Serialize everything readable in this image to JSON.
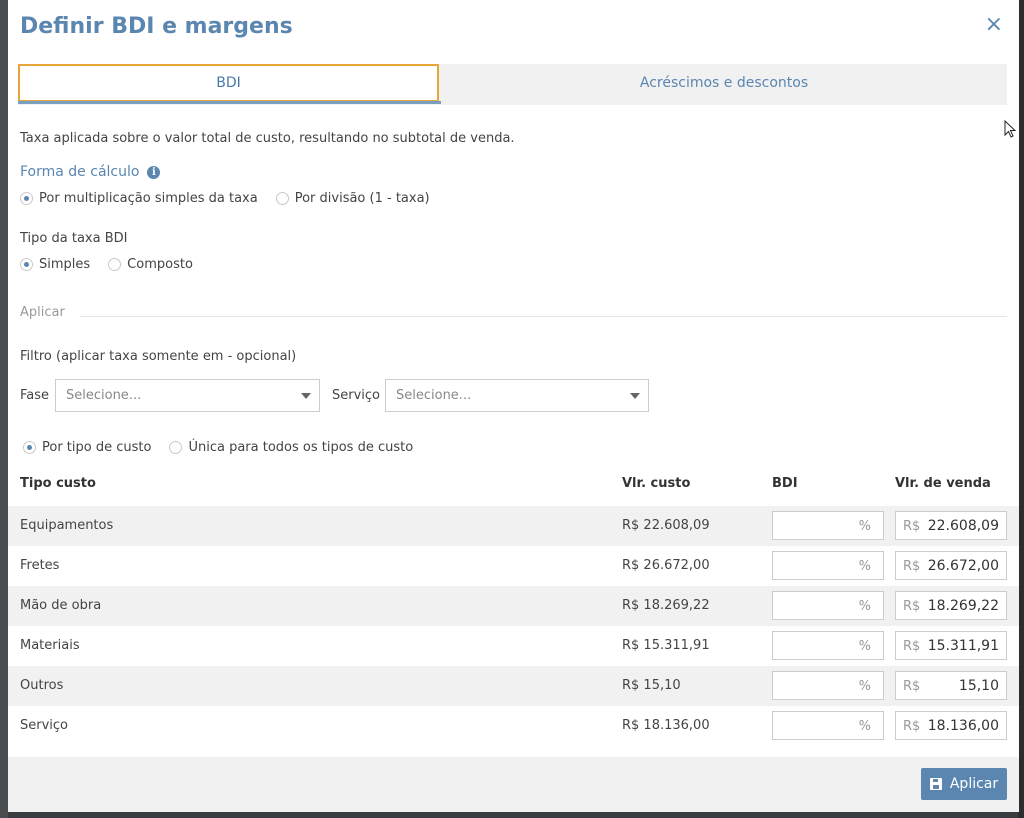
{
  "dialog": {
    "title": "Definir BDI e margens",
    "close_symbol": "×"
  },
  "tabs": [
    {
      "label": "BDI",
      "active": true
    },
    {
      "label": "Acréscimos e descontos",
      "active": false
    }
  ],
  "description": "Taxa aplicada sobre o valor total de custo, resultando no subtotal de venda.",
  "forma_calculo": {
    "label": "Forma de cálculo",
    "info_symbol": "i",
    "options": [
      {
        "label": "Por multiplicação simples da taxa",
        "checked": true
      },
      {
        "label": "Por divisão (1 - taxa)",
        "checked": false
      }
    ]
  },
  "tipo_taxa": {
    "label": "Tipo da taxa BDI",
    "options": [
      {
        "label": "Simples",
        "checked": true
      },
      {
        "label": "Composto",
        "checked": false
      }
    ]
  },
  "aplicar": {
    "heading": "Aplicar",
    "filter_label": "Filtro (aplicar taxa somente em - opcional)",
    "fase_label": "Fase",
    "fase_placeholder": "Selecione...",
    "servico_label": "Serviço",
    "servico_placeholder": "Selecione...",
    "mode_options": [
      {
        "label": "Por tipo de custo",
        "checked": true
      },
      {
        "label": "Única para todos os tipos de custo",
        "checked": false
      }
    ]
  },
  "table": {
    "headers": {
      "tipo": "Tipo custo",
      "custo": "Vlr. custo",
      "bdi": "BDI",
      "venda": "Vlr. de venda"
    },
    "pct_suffix": "%",
    "currency_prefix": "R$",
    "rows": [
      {
        "tipo": "Equipamentos",
        "custo": "R$ 22.608,09",
        "venda": "22.608,09"
      },
      {
        "tipo": "Fretes",
        "custo": "R$ 26.672,00",
        "venda": "26.672,00"
      },
      {
        "tipo": "Mão de obra",
        "custo": "R$ 18.269,22",
        "venda": "18.269,22"
      },
      {
        "tipo": "Materiais",
        "custo": "R$ 15.311,91",
        "venda": "15.311,91"
      },
      {
        "tipo": "Outros",
        "custo": "R$ 15,10",
        "venda": "15,10"
      },
      {
        "tipo": "Serviço",
        "custo": "R$ 18.136,00",
        "venda": "18.136,00"
      }
    ]
  },
  "footer": {
    "apply_label": "Aplicar"
  },
  "colors": {
    "accent": "#5a86b0",
    "tab_highlight": "#e8a63a",
    "row_alt": "#f1f1f1"
  }
}
